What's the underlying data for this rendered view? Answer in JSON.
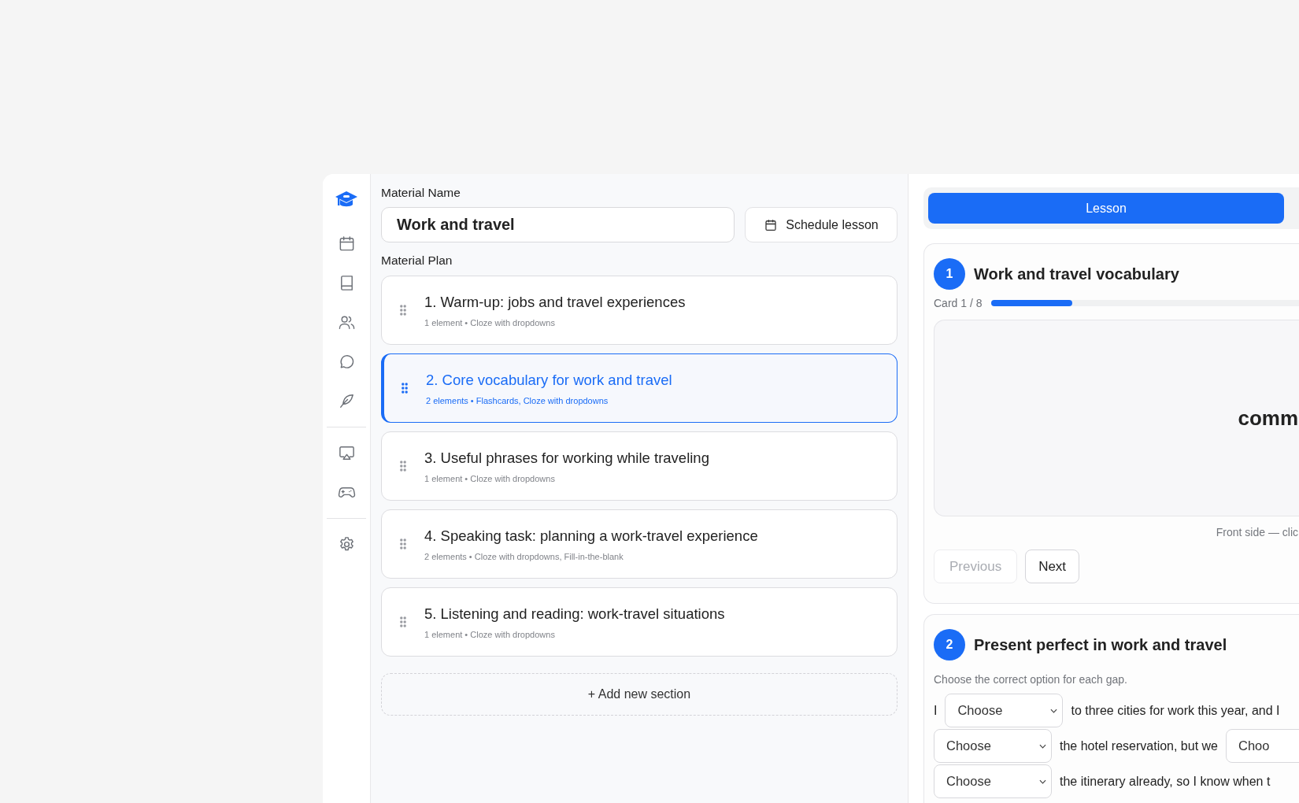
{
  "sidebar": {
    "items": [
      {
        "kind": "calendar"
      },
      {
        "kind": "book"
      },
      {
        "kind": "people"
      },
      {
        "kind": "chat"
      },
      {
        "kind": "feather"
      },
      {
        "kind": "divider"
      },
      {
        "kind": "presentation"
      },
      {
        "kind": "gamepad"
      },
      {
        "kind": "divider"
      },
      {
        "kind": "settings"
      }
    ]
  },
  "material_name": {
    "label": "Material Name",
    "value": "Work and travel"
  },
  "schedule_button": "Schedule lesson",
  "plan": {
    "label": "Material Plan",
    "sections": [
      {
        "title": "1. Warm-up: jobs and travel experiences",
        "meta": "1 element • Cloze with dropdowns",
        "selected": false
      },
      {
        "title": "2. Core vocabulary for work and travel",
        "meta": "2 elements • Flashcards, Cloze with dropdowns",
        "selected": true
      },
      {
        "title": "3. Useful phrases for working while traveling",
        "meta": "1 element • Cloze with dropdowns",
        "selected": false
      },
      {
        "title": "4. Speaking task: planning a work-travel experience",
        "meta": "2 elements • Cloze with dropdowns, Fill-in-the-blank",
        "selected": false
      },
      {
        "title": "5. Listening and reading: work-travel situations",
        "meta": "1 element • Cloze with dropdowns",
        "selected": false
      }
    ],
    "add_button": "+ Add new section"
  },
  "preview": {
    "tab": "Lesson",
    "flashcards": {
      "number": "1",
      "title": "Work and travel vocabulary",
      "counter": "Card 1 / 8",
      "level": 0.125,
      "front_text": "comm",
      "hint": "Front side — clic",
      "buttons": [
        {
          "label": "Previous",
          "disabled": true
        },
        {
          "label": "Next",
          "disabled": false
        }
      ]
    },
    "cloze": {
      "number": "2",
      "title": "Present perfect in work and travel",
      "instruction": "Choose the correct option for each gap.",
      "segments": [
        {
          "kind": "text",
          "text": "I"
        },
        {
          "kind": "select",
          "value": "Choose"
        },
        {
          "kind": "text",
          "text": "to three cities for work this year, and I"
        },
        {
          "kind": "break"
        },
        {
          "kind": "select",
          "value": "Choose"
        },
        {
          "kind": "text",
          "text": "the hotel reservation, but we"
        },
        {
          "kind": "select",
          "value": "Choo"
        },
        {
          "kind": "break"
        },
        {
          "kind": "select",
          "value": "Choose"
        },
        {
          "kind": "text",
          "text": "the itinerary already, so I know when t"
        }
      ]
    }
  }
}
